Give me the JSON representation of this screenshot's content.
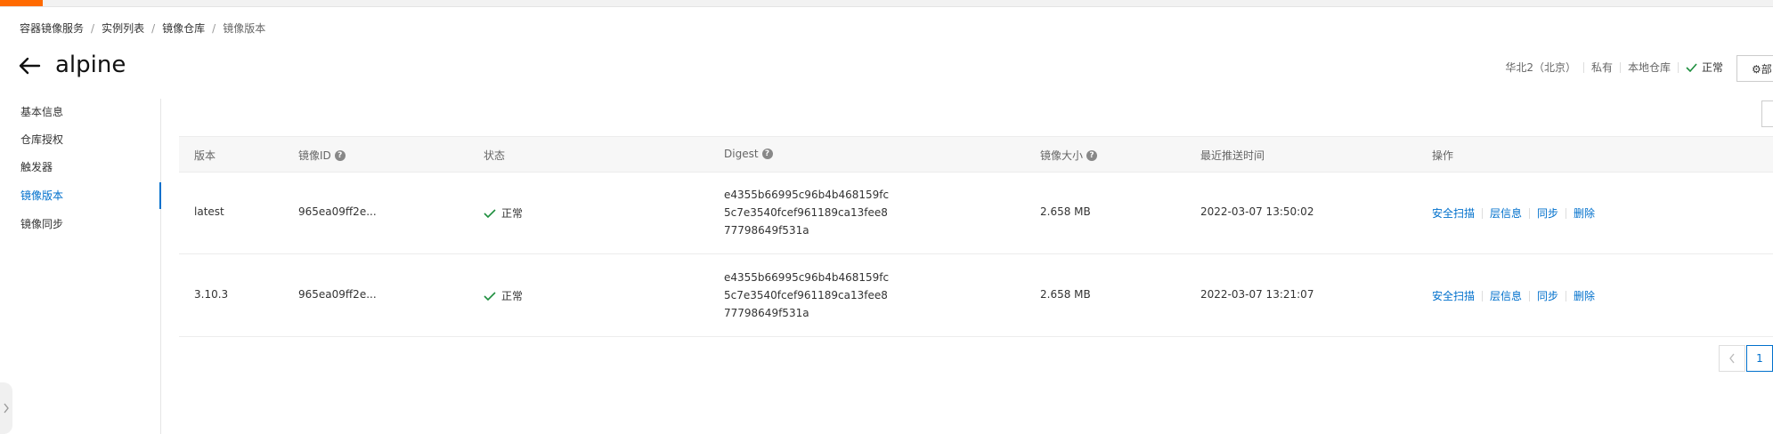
{
  "breadcrumb": [
    {
      "label": "容器镜像服务"
    },
    {
      "label": "实例列表"
    },
    {
      "label": "镜像仓库"
    },
    {
      "label": "镜像版本"
    }
  ],
  "breadcrumb_sep": "/",
  "page": {
    "title": "alpine"
  },
  "repo_status": {
    "region": "华北2（北京）",
    "visibility": "私有",
    "type": "本地仓库",
    "state": "正常"
  },
  "deploy_button": {
    "label": "部"
  },
  "sidebar": {
    "items": [
      {
        "label": "基本信息"
      },
      {
        "label": "仓库授权"
      },
      {
        "label": "触发器"
      },
      {
        "label": "镜像版本",
        "active": true
      },
      {
        "label": "镜像同步"
      }
    ]
  },
  "table": {
    "headers": {
      "tag": "版本",
      "image_id": "镜像ID",
      "status": "状态",
      "digest": "Digest",
      "size": "镜像大小",
      "pushed": "最近推送时间",
      "actions": "操作"
    },
    "rows": [
      {
        "tag": "latest",
        "image_id": "965ea09ff2e...",
        "status": "正常",
        "digest_lines": [
          "e4355b66995c96b4b468159fc",
          "5c7e3540fcef961189ca13fee8",
          "77798649f531a"
        ],
        "size": "2.658 MB",
        "pushed": "2022-03-07 13:50:02"
      },
      {
        "tag": "3.10.3",
        "image_id": "965ea09ff2e...",
        "status": "正常",
        "digest_lines": [
          "e4355b66995c96b4b468159fc",
          "5c7e3540fcef961189ca13fee8",
          "77798649f531a"
        ],
        "size": "2.658 MB",
        "pushed": "2022-03-07 13:21:07"
      }
    ],
    "row_actions": [
      "安全扫描",
      "层信息",
      "同步",
      "删除"
    ]
  },
  "pagination": {
    "current": "1"
  },
  "colors": {
    "accent": "#ff6a00",
    "link": "#0070cc",
    "success": "#1e8e3e"
  }
}
